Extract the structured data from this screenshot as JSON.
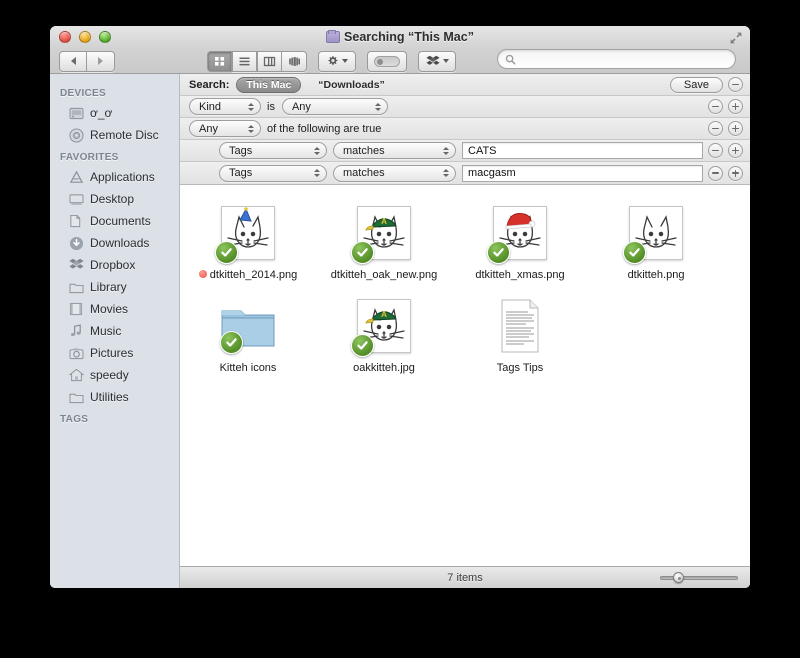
{
  "window": {
    "title": "Searching “This Mac”",
    "title_icon": "purple-folder-icon"
  },
  "toolbar": {
    "back_icon": "back-arrow-icon",
    "forward_icon": "forward-arrow-icon",
    "view_buttons": [
      {
        "name": "icon-view",
        "icon": "grid-icon",
        "active": true
      },
      {
        "name": "list-view",
        "icon": "list-icon",
        "active": false
      },
      {
        "name": "column-view",
        "icon": "columns-icon",
        "active": false
      },
      {
        "name": "coverflow-view",
        "icon": "coverflow-icon",
        "active": false
      }
    ],
    "action_icon": "gear-icon",
    "arrange_icon": "toggle-pill-icon",
    "dropbox_icon": "dropbox-icon",
    "search": {
      "placeholder": "",
      "value": "",
      "icon": "search-icon"
    },
    "fullscreen_icon": "expand-arrows-icon"
  },
  "sidebar": {
    "sections": [
      {
        "header": "DEVICES",
        "items": [
          {
            "label": "ơ_ơ",
            "icon": "hard-drive-icon"
          },
          {
            "label": "Remote Disc",
            "icon": "optical-disc-icon"
          }
        ]
      },
      {
        "header": "FAVORITES",
        "items": [
          {
            "label": "Applications",
            "icon": "applications-icon"
          },
          {
            "label": "Desktop",
            "icon": "desktop-icon"
          },
          {
            "label": "Documents",
            "icon": "documents-icon"
          },
          {
            "label": "Downloads",
            "icon": "downloads-icon"
          },
          {
            "label": "Dropbox",
            "icon": "dropbox-icon"
          },
          {
            "label": "Library",
            "icon": "folder-icon"
          },
          {
            "label": "Movies",
            "icon": "movies-icon"
          },
          {
            "label": "Music",
            "icon": "music-note-icon"
          },
          {
            "label": "Pictures",
            "icon": "camera-icon"
          },
          {
            "label": "speedy",
            "icon": "home-icon"
          },
          {
            "label": "Utilities",
            "icon": "folder-icon"
          }
        ]
      },
      {
        "header": "TAGS",
        "items": []
      }
    ]
  },
  "search_bar": {
    "label": "Search:",
    "scopes": [
      {
        "label": "This Mac",
        "selected": true
      },
      {
        "label": "“Downloads”",
        "selected": false
      }
    ],
    "save_label": "Save",
    "remove_icon": "minus-icon",
    "add_icon": "plus-icon"
  },
  "criteria_rows": [
    {
      "indent": false,
      "selects": [
        {
          "name": "attribute-select",
          "value": "Kind",
          "class": "kind"
        }
      ],
      "text_between": "is",
      "selects_after": [
        {
          "name": "value-select",
          "value": "Any",
          "class": "isany"
        }
      ],
      "input": null,
      "trailing_text": null
    },
    {
      "indent": false,
      "selects": [
        {
          "name": "match-mode-select",
          "value": "Any",
          "class": "anyof"
        }
      ],
      "text_between": null,
      "selects_after": [],
      "input": null,
      "trailing_text": "of the following are true"
    },
    {
      "indent": true,
      "selects": [
        {
          "name": "attribute-select",
          "value": "Tags",
          "class": "tagsel"
        },
        {
          "name": "operator-select",
          "value": "matches",
          "class": "matchsel"
        }
      ],
      "text_between": null,
      "selects_after": [],
      "input": {
        "name": "criteria-value-input",
        "value": "CATS"
      },
      "trailing_text": null
    },
    {
      "indent": true,
      "selects": [
        {
          "name": "attribute-select",
          "value": "Tags",
          "class": "tagsel"
        },
        {
          "name": "operator-select",
          "value": "matches",
          "class": "matchsel"
        }
      ],
      "text_between": null,
      "selects_after": [],
      "input": {
        "name": "criteria-value-input",
        "value": "macgasm"
      },
      "trailing_text": null
    }
  ],
  "files": {
    "rows": [
      [
        {
          "name": "dtkitteh_2014.png",
          "type": "image",
          "icon": "cat-drawing-blue-party-hat",
          "badge": "green-check-badge",
          "tag_dot": "#ef6558",
          "hat": "blue"
        },
        {
          "name": "dtkitteh_oak_new.png",
          "type": "image",
          "icon": "cat-drawing-green-cap",
          "badge": "green-check-badge",
          "tag_dot": null,
          "hat": "green"
        },
        {
          "name": "dtkitteh_xmas.png",
          "type": "image",
          "icon": "cat-drawing-santa-hat",
          "badge": "green-check-badge",
          "tag_dot": null,
          "hat": "red"
        },
        {
          "name": "dtkitteh.png",
          "type": "image",
          "icon": "cat-drawing-plain",
          "badge": "green-check-badge",
          "tag_dot": null,
          "hat": "none"
        }
      ],
      [
        {
          "name": "Kitteh icons",
          "type": "folder",
          "icon": "blue-folder-icon",
          "badge": "green-check-badge",
          "tag_dot": null,
          "hat": null
        },
        {
          "name": "oakkitteh.jpg",
          "type": "image",
          "icon": "cat-drawing-green-cap",
          "badge": "green-check-badge",
          "tag_dot": null,
          "hat": "green"
        },
        {
          "name": "Tags Tips",
          "type": "document",
          "icon": "text-document-icon",
          "badge": null,
          "tag_dot": null,
          "hat": null
        }
      ]
    ]
  },
  "statusbar": {
    "item_count": "7 items",
    "zoom_slider": "icon-size-slider"
  }
}
